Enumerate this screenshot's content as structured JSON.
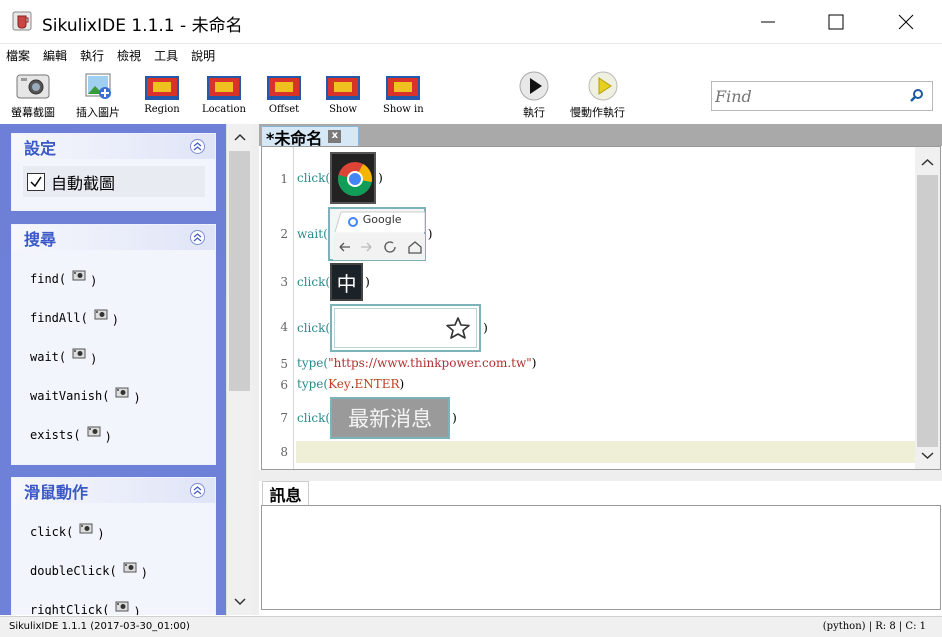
{
  "window": {
    "title": "SikulixIDE 1.1.1 - 未命名",
    "minimize": "─",
    "maximize": "☐",
    "close": "✕"
  },
  "menu": [
    "檔案",
    "編輯",
    "執行",
    "檢視",
    "工具",
    "說明"
  ],
  "toolbar": {
    "screenshot": "螢幕截圖",
    "insert_image": "插入圖片",
    "region": "Region",
    "location": "Location",
    "offset": "Offset",
    "show": "Show",
    "show_in": "Show in",
    "run": "執行",
    "run_slow": "慢動作執行",
    "find_placeholder": "Find"
  },
  "sidebar": {
    "settings": {
      "title": "設定",
      "auto_capture": "自動截圖",
      "auto_capture_checked": true
    },
    "search": {
      "title": "搜尋",
      "commands": [
        "find(",
        "findAll(",
        "wait(",
        "waitVanish(",
        "exists("
      ]
    },
    "mouse": {
      "title": "滑鼠動作",
      "commands": [
        "click(",
        "doubleClick(",
        "rightClick("
      ]
    }
  },
  "editor": {
    "tab_label": "*未命名",
    "tab_close": "x",
    "line_numbers": [
      "1",
      "2",
      "3",
      "4",
      "5",
      "6",
      "7",
      "8"
    ],
    "lines": [
      {
        "fn": "click(",
        "image": "chrome-logo",
        "close": ")"
      },
      {
        "fn": "wait(",
        "image": "google-browser-tab",
        "image_text": "Google",
        "close": ")"
      },
      {
        "fn": "click(",
        "image": "chinese-input-button",
        "image_text": "中",
        "close": ")"
      },
      {
        "fn": "click(",
        "image": "address-bar-star",
        "close": ")"
      },
      {
        "fn": "type(",
        "string": "\"https://www.thinkpower.com.tw\"",
        "close": ")"
      },
      {
        "fn": "type(",
        "key": "Key",
        "dot": ".",
        "const": "ENTER",
        "close": ")"
      },
      {
        "fn": "click(",
        "image": "latest-news-button",
        "image_text": "最新消息",
        "close": ")"
      }
    ]
  },
  "messages": {
    "tab_label": "訊息"
  },
  "status": {
    "left": "SikulixIDE 1.1.1 (2017-03-30_01:00)",
    "right": "(python) | R: 8 | C: 1"
  }
}
